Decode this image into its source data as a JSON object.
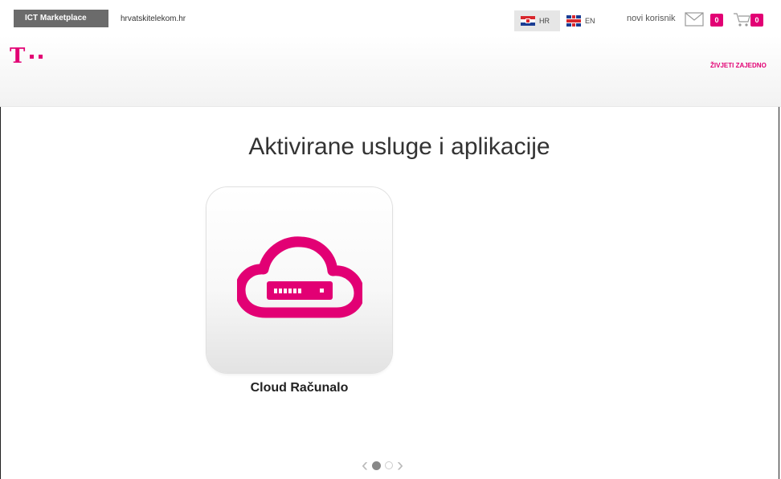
{
  "topbar": {
    "marketplace_tab": "ICT Marketplace",
    "site_link": "hrvatskitelekom.hr",
    "lang_hr": "HR",
    "lang_en": "EN",
    "user_label": "novi korisnik",
    "mail_count": "0",
    "cart_count": "0"
  },
  "header": {
    "logo_letter": "T",
    "slogan": "ŽIVJETI ZAJEDNO"
  },
  "main": {
    "title": "Aktivirane usluge i aplikacije",
    "apps": [
      {
        "label": "Cloud Računalo",
        "icon": "cloud-server-icon"
      }
    ]
  },
  "pager": {
    "active_page": 1,
    "page_count": 2
  },
  "colors": {
    "brand": "#e20074",
    "tab_bg": "#6b6b6b"
  }
}
